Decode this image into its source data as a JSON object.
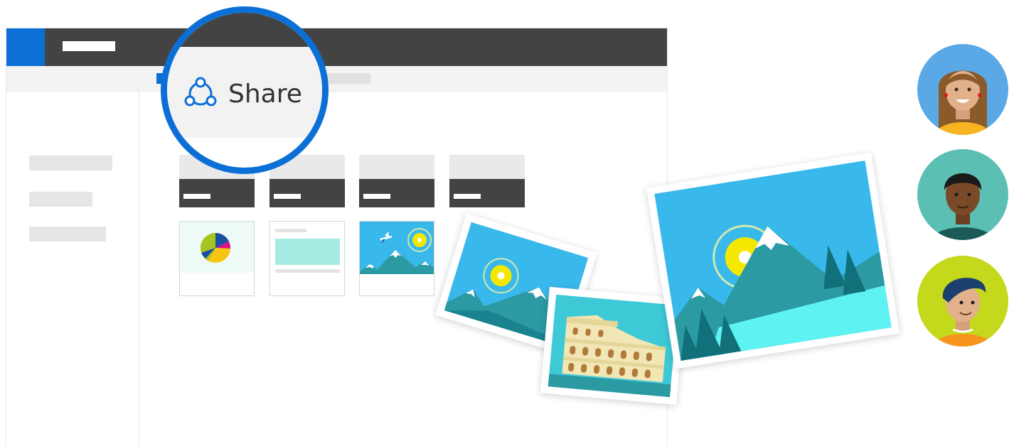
{
  "share_button": {
    "label": "Share",
    "icon": "share-icon"
  },
  "avatars": [
    {
      "name": "avatar-woman",
      "bg": "#5aa9e6"
    },
    {
      "name": "avatar-man",
      "bg": "#5bbfb3"
    },
    {
      "name": "avatar-boy",
      "bg": "#c4d81c"
    }
  ],
  "colors": {
    "accent": "#0b6fd6",
    "topbar": "#434343",
    "sky": "#39b8ec",
    "mountain": "#2c9aa3"
  }
}
